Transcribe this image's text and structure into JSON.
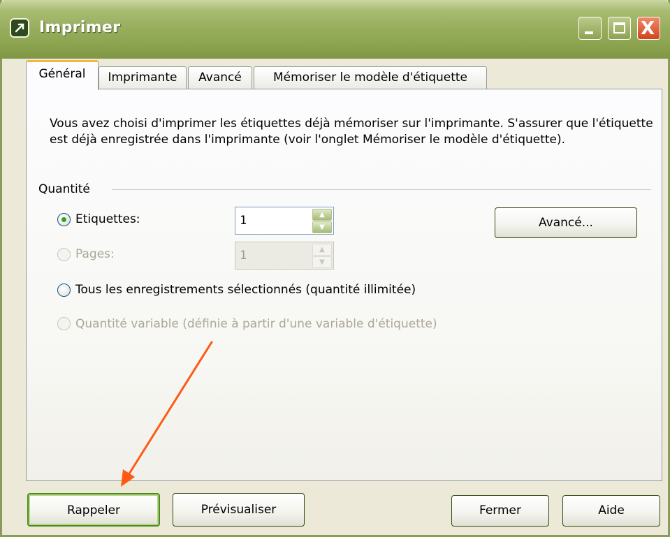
{
  "window": {
    "title": "Imprimer",
    "app_icon": "app-logo-icon",
    "controls": {
      "minimize_icon": "minimize-icon",
      "maximize_icon": "maximize-icon",
      "close_icon": "close-icon",
      "close_glyph": "X"
    }
  },
  "tabs": [
    {
      "label": "Général",
      "active": true
    },
    {
      "label": "Imprimante",
      "active": false
    },
    {
      "label": "Avancé",
      "active": false
    },
    {
      "label": "Mémoriser  le modèle d'étiquette",
      "active": false
    }
  ],
  "general": {
    "description": "Vous avez choisi d'imprimer les étiquettes déjà mémoriser sur l'imprimante. S'assurer que l'étiquette est déjà enregistrée dans l'imprimante (voir l'onglet Mémoriser le modèle d'étiquette).",
    "quantity_group_label": "Quantité",
    "options": {
      "etiquettes": {
        "label": "Etiquettes:",
        "value": "1",
        "selected": true,
        "enabled": true
      },
      "pages": {
        "label": "Pages:",
        "value": "1",
        "selected": false,
        "enabled": false
      },
      "tous": {
        "label": "Tous les enregistrements sélectionnés (quantité illimitée)",
        "selected": false,
        "enabled": true
      },
      "variable": {
        "label": "Quantité variable (définie à partir d'une variable d'étiquette)",
        "selected": false,
        "enabled": false
      }
    },
    "advanced_button_label": "Avancé..."
  },
  "footer": {
    "rappeler_label": "Rappeler",
    "previsualiser_label": "Prévisualiser",
    "fermer_label": "Fermer",
    "aide_label": "Aide"
  },
  "colors": {
    "titlebar": "#97ad5c",
    "accent_green": "#33a02a",
    "annotation_arrow": "#ff5a14",
    "active_tab_highlight": "#f6b43c"
  }
}
